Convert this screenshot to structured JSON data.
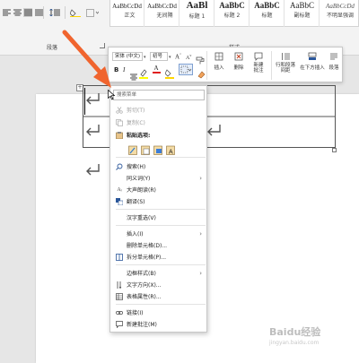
{
  "ribbon": {
    "group_paragraph_label": "段落",
    "group_styles_label": "样式",
    "styles": [
      {
        "sample": "AaBbCcDd",
        "name": "正文"
      },
      {
        "sample": "AaBbCcDd",
        "name": "无间隔"
      },
      {
        "sample": "AaBl",
        "name": "标题 1"
      },
      {
        "sample": "AaBbC",
        "name": "标题 2"
      },
      {
        "sample": "AaBbC",
        "name": "标题"
      },
      {
        "sample": "AaBbC",
        "name": "副标题"
      },
      {
        "sample": "AaBbCcDd",
        "name": "不明显强调"
      }
    ]
  },
  "mini_toolbar": {
    "font_name": "宋体 (中文)",
    "font_size": "初号",
    "font_color_letter": "A",
    "highlight_letter": "A",
    "buttons": [
      {
        "label": "插入"
      },
      {
        "label": "删除"
      },
      {
        "label": "新建\n批注"
      },
      {
        "label": "行和段落\n间距"
      },
      {
        "label": "在下方插入"
      },
      {
        "label": "段落"
      }
    ],
    "bold_label": "B",
    "italic_label": "I"
  },
  "context_menu": {
    "search_placeholder": "搜索菜单",
    "items": [
      {
        "label": "剪切(T)",
        "icon": "scissors-icon",
        "disabled": true
      },
      {
        "label": "复制(C)",
        "icon": "copy-icon",
        "disabled": true
      },
      {
        "label": "粘贴选项:",
        "icon": "paste-icon",
        "bold": true
      },
      {
        "label": "搜索(H)",
        "icon": "search-icon"
      },
      {
        "label": "同义词(Y)",
        "icon": "",
        "submenu": true
      },
      {
        "label": "大声朗读(R)",
        "icon": "read-aloud-icon"
      },
      {
        "label": "翻译(S)",
        "icon": "translate-icon"
      },
      {
        "label": "汉字重选(V)",
        "icon": ""
      },
      {
        "label": "插入(I)",
        "icon": "",
        "submenu": true
      },
      {
        "label": "删除单元格(D)...",
        "icon": ""
      },
      {
        "label": "拆分单元格(P)...",
        "icon": "split-cells-icon"
      },
      {
        "label": "边框样式(B)",
        "icon": "",
        "submenu": true
      },
      {
        "label": "文字方向(X)...",
        "icon": "text-direction-icon"
      },
      {
        "label": "表格属性(R)...",
        "icon": "table-properties-icon"
      },
      {
        "label": "链接(I)",
        "icon": "link-icon"
      },
      {
        "label": "新建批注(M)",
        "icon": "new-comment-icon"
      }
    ]
  },
  "colors": {
    "arrow": "#f0642e",
    "page": "#ffffff",
    "ribbon": "#f3f3f3",
    "accent": "#2b579a"
  },
  "watermark": "Baidu经验",
  "watermark_sub": "jingyan.baidu.com"
}
